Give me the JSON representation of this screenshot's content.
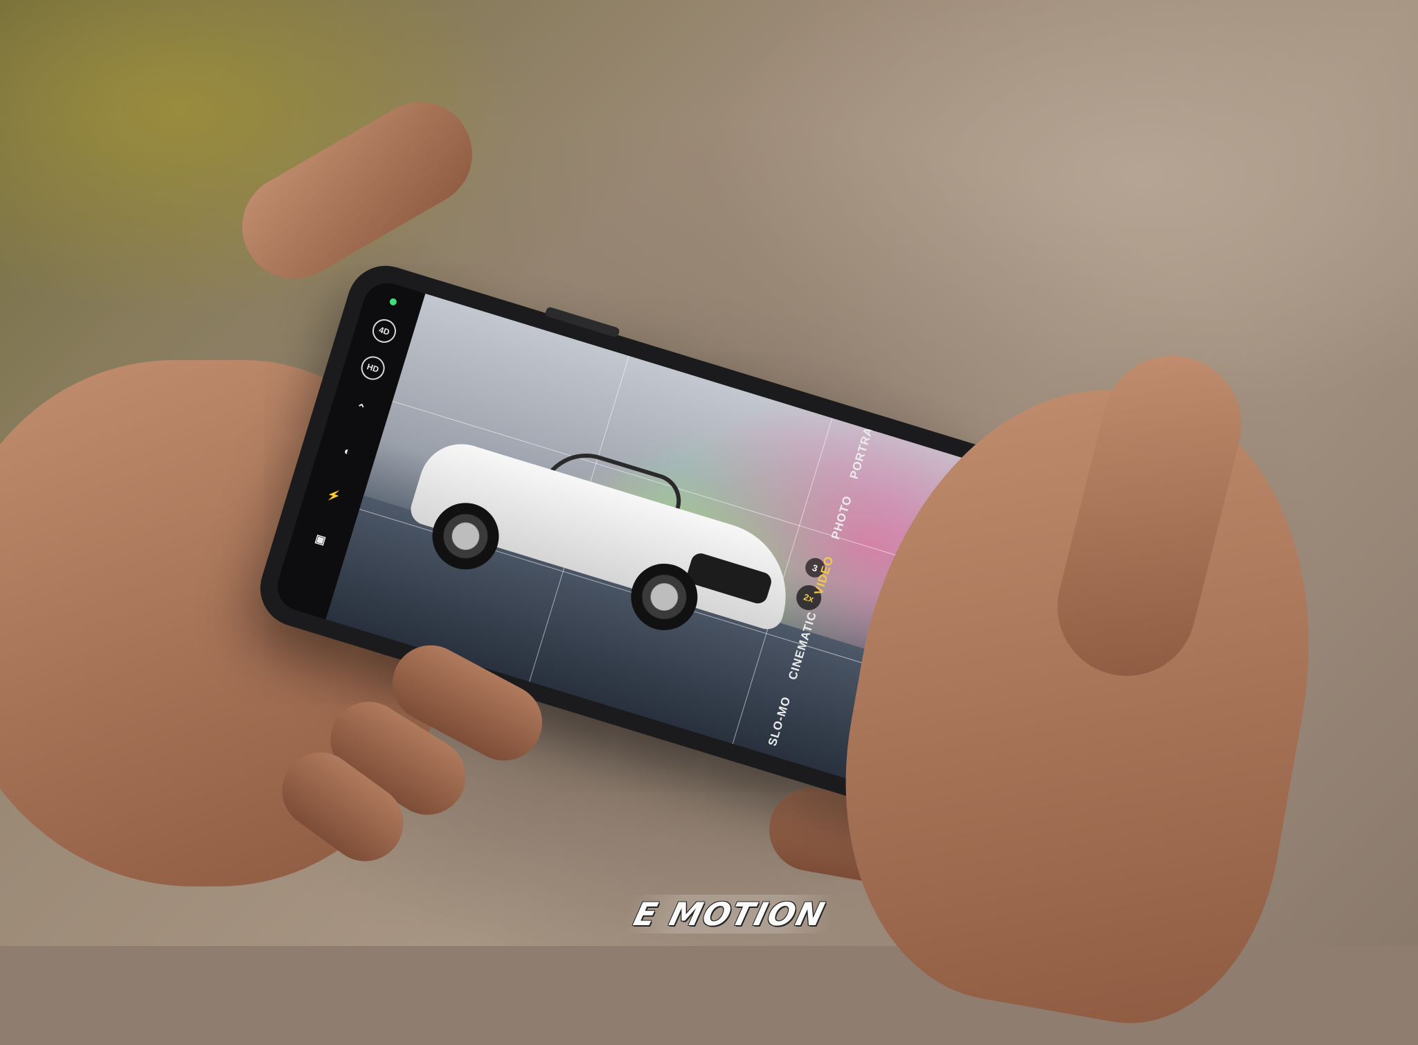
{
  "camera_ui": {
    "left_controls": [
      "4D",
      "HD"
    ],
    "zoom_levels": [
      "3",
      "2x"
    ],
    "modes": [
      "SLO-MO",
      "CINEMATIC",
      "VIDEO",
      "PHOTO",
      "PORTRAIT"
    ],
    "active_mode": "VIDEO"
  },
  "watermark": {
    "text": "E MOTION"
  },
  "colors": {
    "shutter": "#e0553f",
    "active_mode": "#f2c94c"
  }
}
